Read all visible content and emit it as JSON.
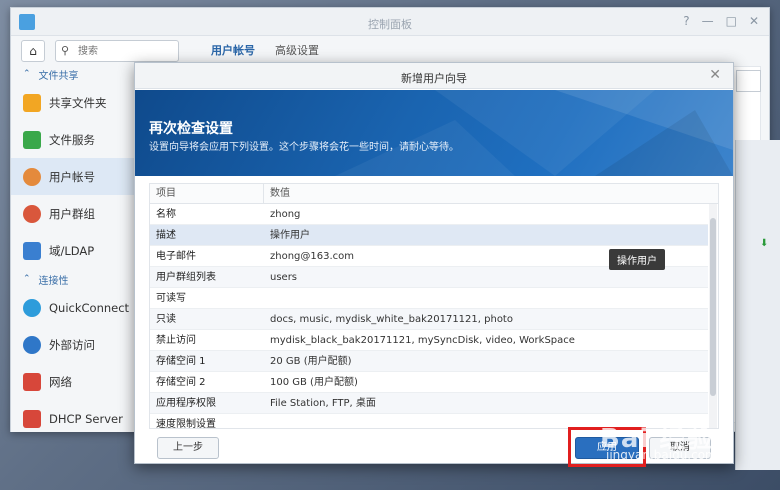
{
  "control_panel": {
    "title": "控制面板",
    "search_placeholder": "搜索",
    "sections": [
      {
        "label": "文件共享",
        "items": [
          "共享文件夹",
          "文件服务",
          "用户帐号",
          "用户群组",
          "域/LDAP"
        ]
      },
      {
        "label": "连接性",
        "items": [
          "QuickConnect",
          "外部访问",
          "网络",
          "DHCP Server"
        ]
      }
    ],
    "tabs": [
      "用户帐号",
      "高级设置"
    ],
    "window_controls": [
      "?",
      "—",
      "□",
      "✕"
    ]
  },
  "wizard": {
    "title": "新增用户向导",
    "heading": "再次检查设置",
    "subtitle": "设置向导将会应用下列设置。这个步骤将会花一些时间，请耐心等待。",
    "columns": [
      "项目",
      "数值"
    ],
    "rows": [
      {
        "key": "名称",
        "value": "zhong"
      },
      {
        "key": "描述",
        "value": "操作用户"
      },
      {
        "key": "电子邮件",
        "value": "zhong@163.com"
      },
      {
        "key": "用户群组列表",
        "value": "users"
      },
      {
        "key": "可读写",
        "value": ""
      },
      {
        "key": "只读",
        "value": "docs, music, mydisk_white_bak20171121, photo"
      },
      {
        "key": "禁止访问",
        "value": "mydisk_black_bak20171121, mySyncDisk, video, WorkSpace"
      },
      {
        "key": "存储空间 1",
        "value": "20 GB (用户配额)"
      },
      {
        "key": "存储空间 2",
        "value": "100 GB (用户配额)"
      },
      {
        "key": "应用程序权限",
        "value": "File Station, FTP, 桌面"
      },
      {
        "key": "速度限制设置",
        "value": ""
      }
    ],
    "tooltip": "操作用户",
    "prev_label": "上一步",
    "apply_label": "应用",
    "cancel_label": "取消"
  },
  "watermark": {
    "text": "Bai 经验",
    "sub": "jingyan.baidu.com"
  },
  "colors": {
    "accent": "#2a6fbf",
    "banner": "#1a64b0",
    "highlight": "#e11f1f"
  }
}
